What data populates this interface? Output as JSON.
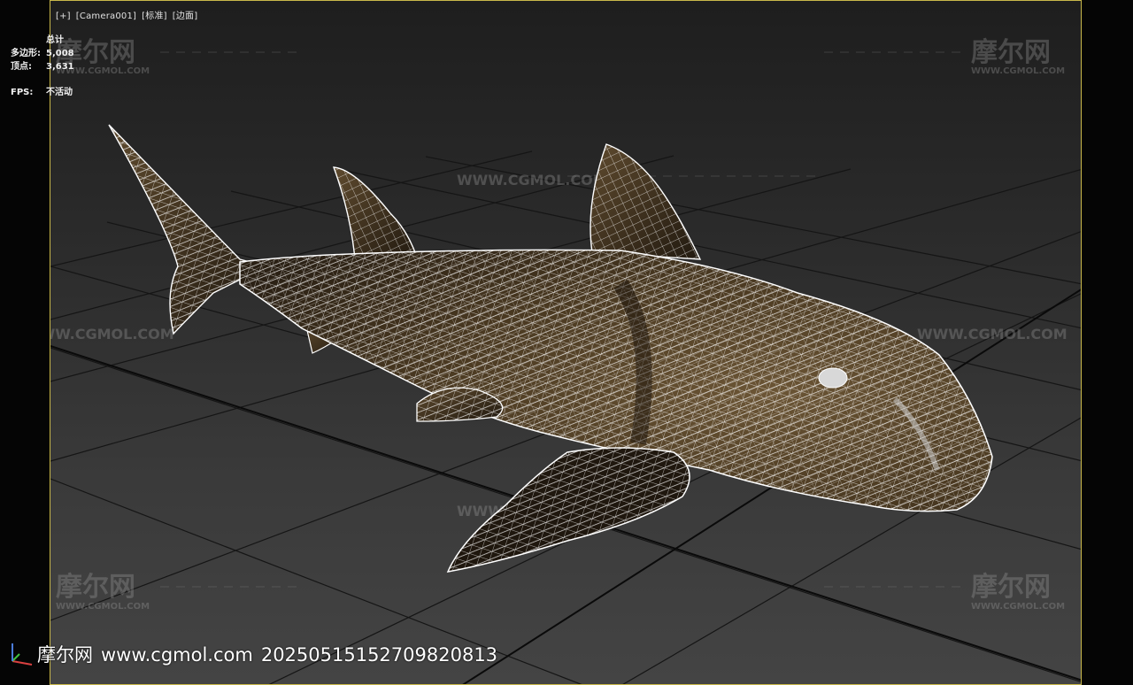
{
  "viewport": {
    "label_plus": "[+]",
    "label_camera": "[Camera001]",
    "label_mode": "[标准]",
    "label_shading": "[边面]"
  },
  "stats": {
    "total_label": "总计",
    "polygons_label": "多边形:",
    "polygons_value": "5,008",
    "vertices_label": "顶点:",
    "vertices_value": "3,631",
    "fps_label": "FPS:",
    "fps_value": "不活动"
  },
  "watermark": {
    "logo_text": "摩尔网",
    "url_text": "WWW.CGMOL.COM"
  },
  "footer": {
    "site_name": "摩尔网",
    "url": "www.cgmol.com",
    "id": "20250515152709820813"
  },
  "colors": {
    "viewport_border": "#c9b84a",
    "shark_body": "#4b3a24",
    "wireframe": "#ffffff",
    "grid_line": "#161616"
  },
  "icons": [
    "axis-gizmo-icon"
  ]
}
